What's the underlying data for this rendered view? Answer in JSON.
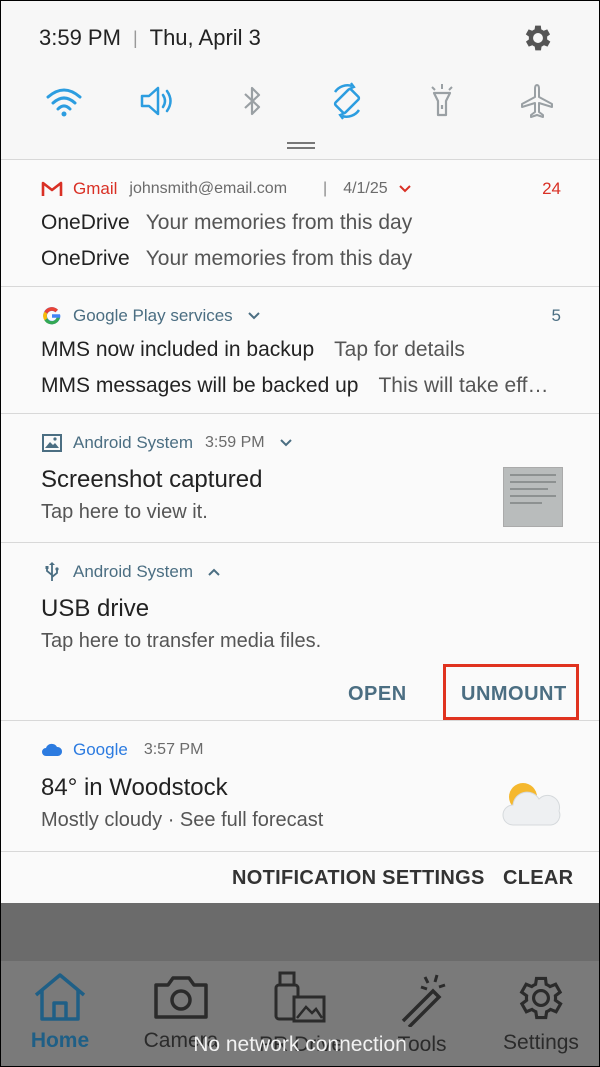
{
  "status": {
    "time": "3:59 PM",
    "date": "Thu, April 3"
  },
  "quick_toggles": [
    {
      "name": "wifi-icon",
      "active": true
    },
    {
      "name": "volume-icon",
      "active": true
    },
    {
      "name": "bluetooth-icon",
      "active": false
    },
    {
      "name": "auto-rotate-icon",
      "active": true
    },
    {
      "name": "flashlight-icon",
      "active": false
    },
    {
      "name": "airplane-mode-icon",
      "active": false
    }
  ],
  "notifications": {
    "gmail": {
      "app": "Gmail",
      "account": "johnsmith@email.com",
      "divider": "|",
      "date": "4/1/25",
      "count": "24",
      "lines": [
        {
          "sender": "OneDrive",
          "text": "Your memories from this day"
        },
        {
          "sender": "OneDrive",
          "text": "Your memories from this day"
        }
      ]
    },
    "play_services": {
      "app": "Google Play services",
      "count": "5",
      "lines": [
        {
          "title": "MMS now included in backup",
          "text": "Tap for details"
        },
        {
          "title": "MMS messages will be backed up",
          "text": "This will take eff…"
        }
      ]
    },
    "screenshot": {
      "app": "Android System",
      "time": "3:59 PM",
      "title": "Screenshot captured",
      "body": "Tap here to view it."
    },
    "usb": {
      "app": "Android System",
      "title": "USB drive",
      "body": "Tap here to transfer media files.",
      "open_label": "OPEN",
      "unmount_label": "UNMOUNT"
    },
    "weather": {
      "app": "Google",
      "time": "3:57 PM",
      "title": "84° in Woodstock",
      "body": "Mostly cloudy · See full forecast"
    }
  },
  "footer": {
    "settings_label": "NOTIFICATION SETTINGS",
    "clear_label": "CLEAR"
  },
  "bottom_nav": [
    {
      "label": "Home",
      "icon": "home-icon",
      "selected": true
    },
    {
      "label": "Camera",
      "icon": "camera-icon"
    },
    {
      "label": "PR Drive",
      "icon": "drive-icon"
    },
    {
      "label": "Tools",
      "icon": "tools-icon"
    },
    {
      "label": "Settings",
      "icon": "settings-icon"
    }
  ],
  "toast": "No network connection",
  "colors": {
    "accent": "#2c9de0",
    "gmail_red": "#d93025",
    "action": "#4b6e82",
    "highlight": "#e0321f"
  }
}
